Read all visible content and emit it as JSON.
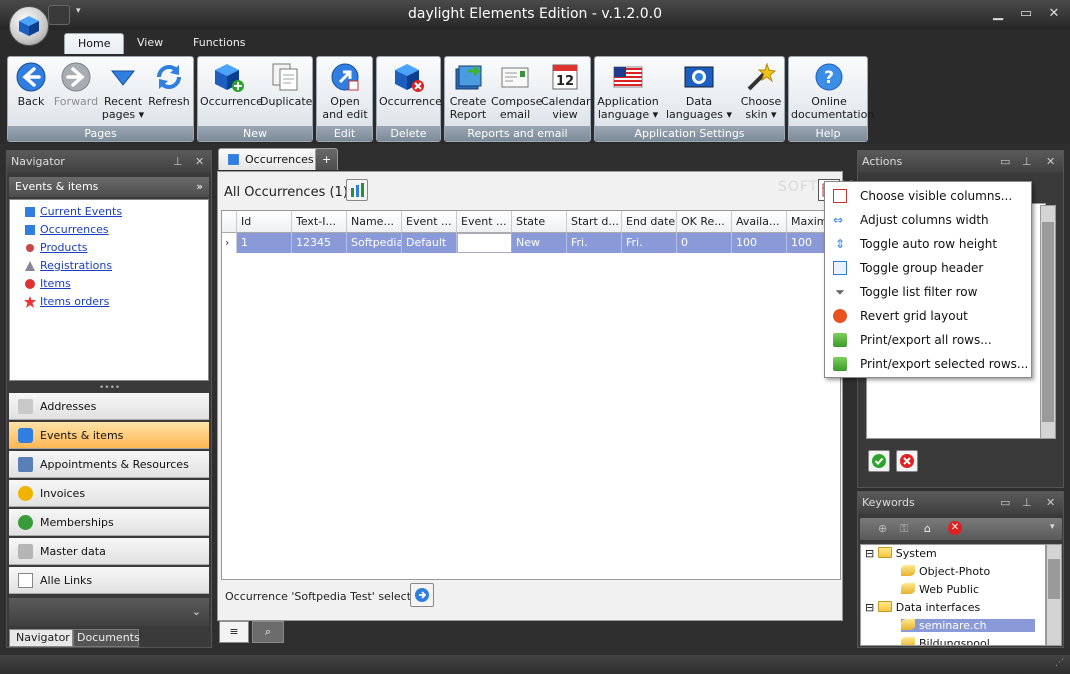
{
  "window": {
    "title": "daylight Elements Edition - v.1.2.0.0"
  },
  "ribbon_tabs": [
    "Home",
    "View",
    "Functions"
  ],
  "ribbon": {
    "pages": {
      "label": "Pages",
      "back": "Back",
      "forward": "Forward",
      "recent_pages": "Recent pages",
      "refresh": "Refresh"
    },
    "new": {
      "label": "New",
      "occurrence": "Occurrence",
      "duplicate": "Duplicate"
    },
    "edit": {
      "label": "Edit",
      "open_and_edit": "Open and edit"
    },
    "delete": {
      "label": "Delete",
      "occurrence": "Occurrence"
    },
    "reports": {
      "label": "Reports and email",
      "create_report": "Create Report",
      "compose_email": "Compose email",
      "calendar_view": "Calendar view",
      "calendar_day": "12"
    },
    "settings": {
      "label": "Application Settings",
      "app_language": "Application language",
      "data_languages": "Data languages",
      "choose_skin": "Choose skin"
    },
    "help": {
      "label": "Help",
      "online_docs": "Online documentation"
    }
  },
  "navigator": {
    "title": "Navigator",
    "section": "Events & items",
    "links": [
      "Current Events",
      "Occurrences",
      "Products",
      "Registrations",
      "Items",
      "Items orders"
    ],
    "buttons": [
      "Addresses",
      "Events & items",
      "Appointments & Resources",
      "Invoices",
      "Memberships",
      "Master data",
      "Alle Links"
    ],
    "bottom_tabs": [
      "Navigator",
      "Documents"
    ]
  },
  "document": {
    "tab": "Occurrences",
    "add_tab": "+",
    "header": "All Occurrences (1)",
    "columns": [
      "Id",
      "Text-I...",
      "Name...",
      "Event ...",
      "Event ...",
      "State",
      "Start d...",
      "End date",
      "OK Re...",
      "Availa...",
      "Maxim..."
    ],
    "rows": [
      [
        "1",
        "12345",
        "Softpedia",
        "Default",
        "",
        "New",
        "Fri.",
        "Fri.",
        "0",
        "100",
        "100"
      ]
    ],
    "status": "Occurrence 'Softpedia Test' selected"
  },
  "context_menu": [
    "Choose visible columns...",
    "Adjust columns width",
    "Toggle auto row height",
    "Toggle group header",
    "Toggle list filter row",
    "Revert grid layout",
    "Print/export all rows...",
    "Print/export selected rows..."
  ],
  "actions": {
    "title": "Actions"
  },
  "keywords": {
    "title": "Keywords",
    "tree": [
      {
        "label": "System",
        "type": "folder"
      },
      {
        "label": "Object-Photo",
        "type": "key"
      },
      {
        "label": "Web Public",
        "type": "key"
      },
      {
        "label": "Data interfaces",
        "type": "folder"
      },
      {
        "label": "seminare.ch",
        "type": "key"
      },
      {
        "label": "Bildungspool",
        "type": "key"
      }
    ]
  },
  "watermark": "SOFTPEDIA"
}
